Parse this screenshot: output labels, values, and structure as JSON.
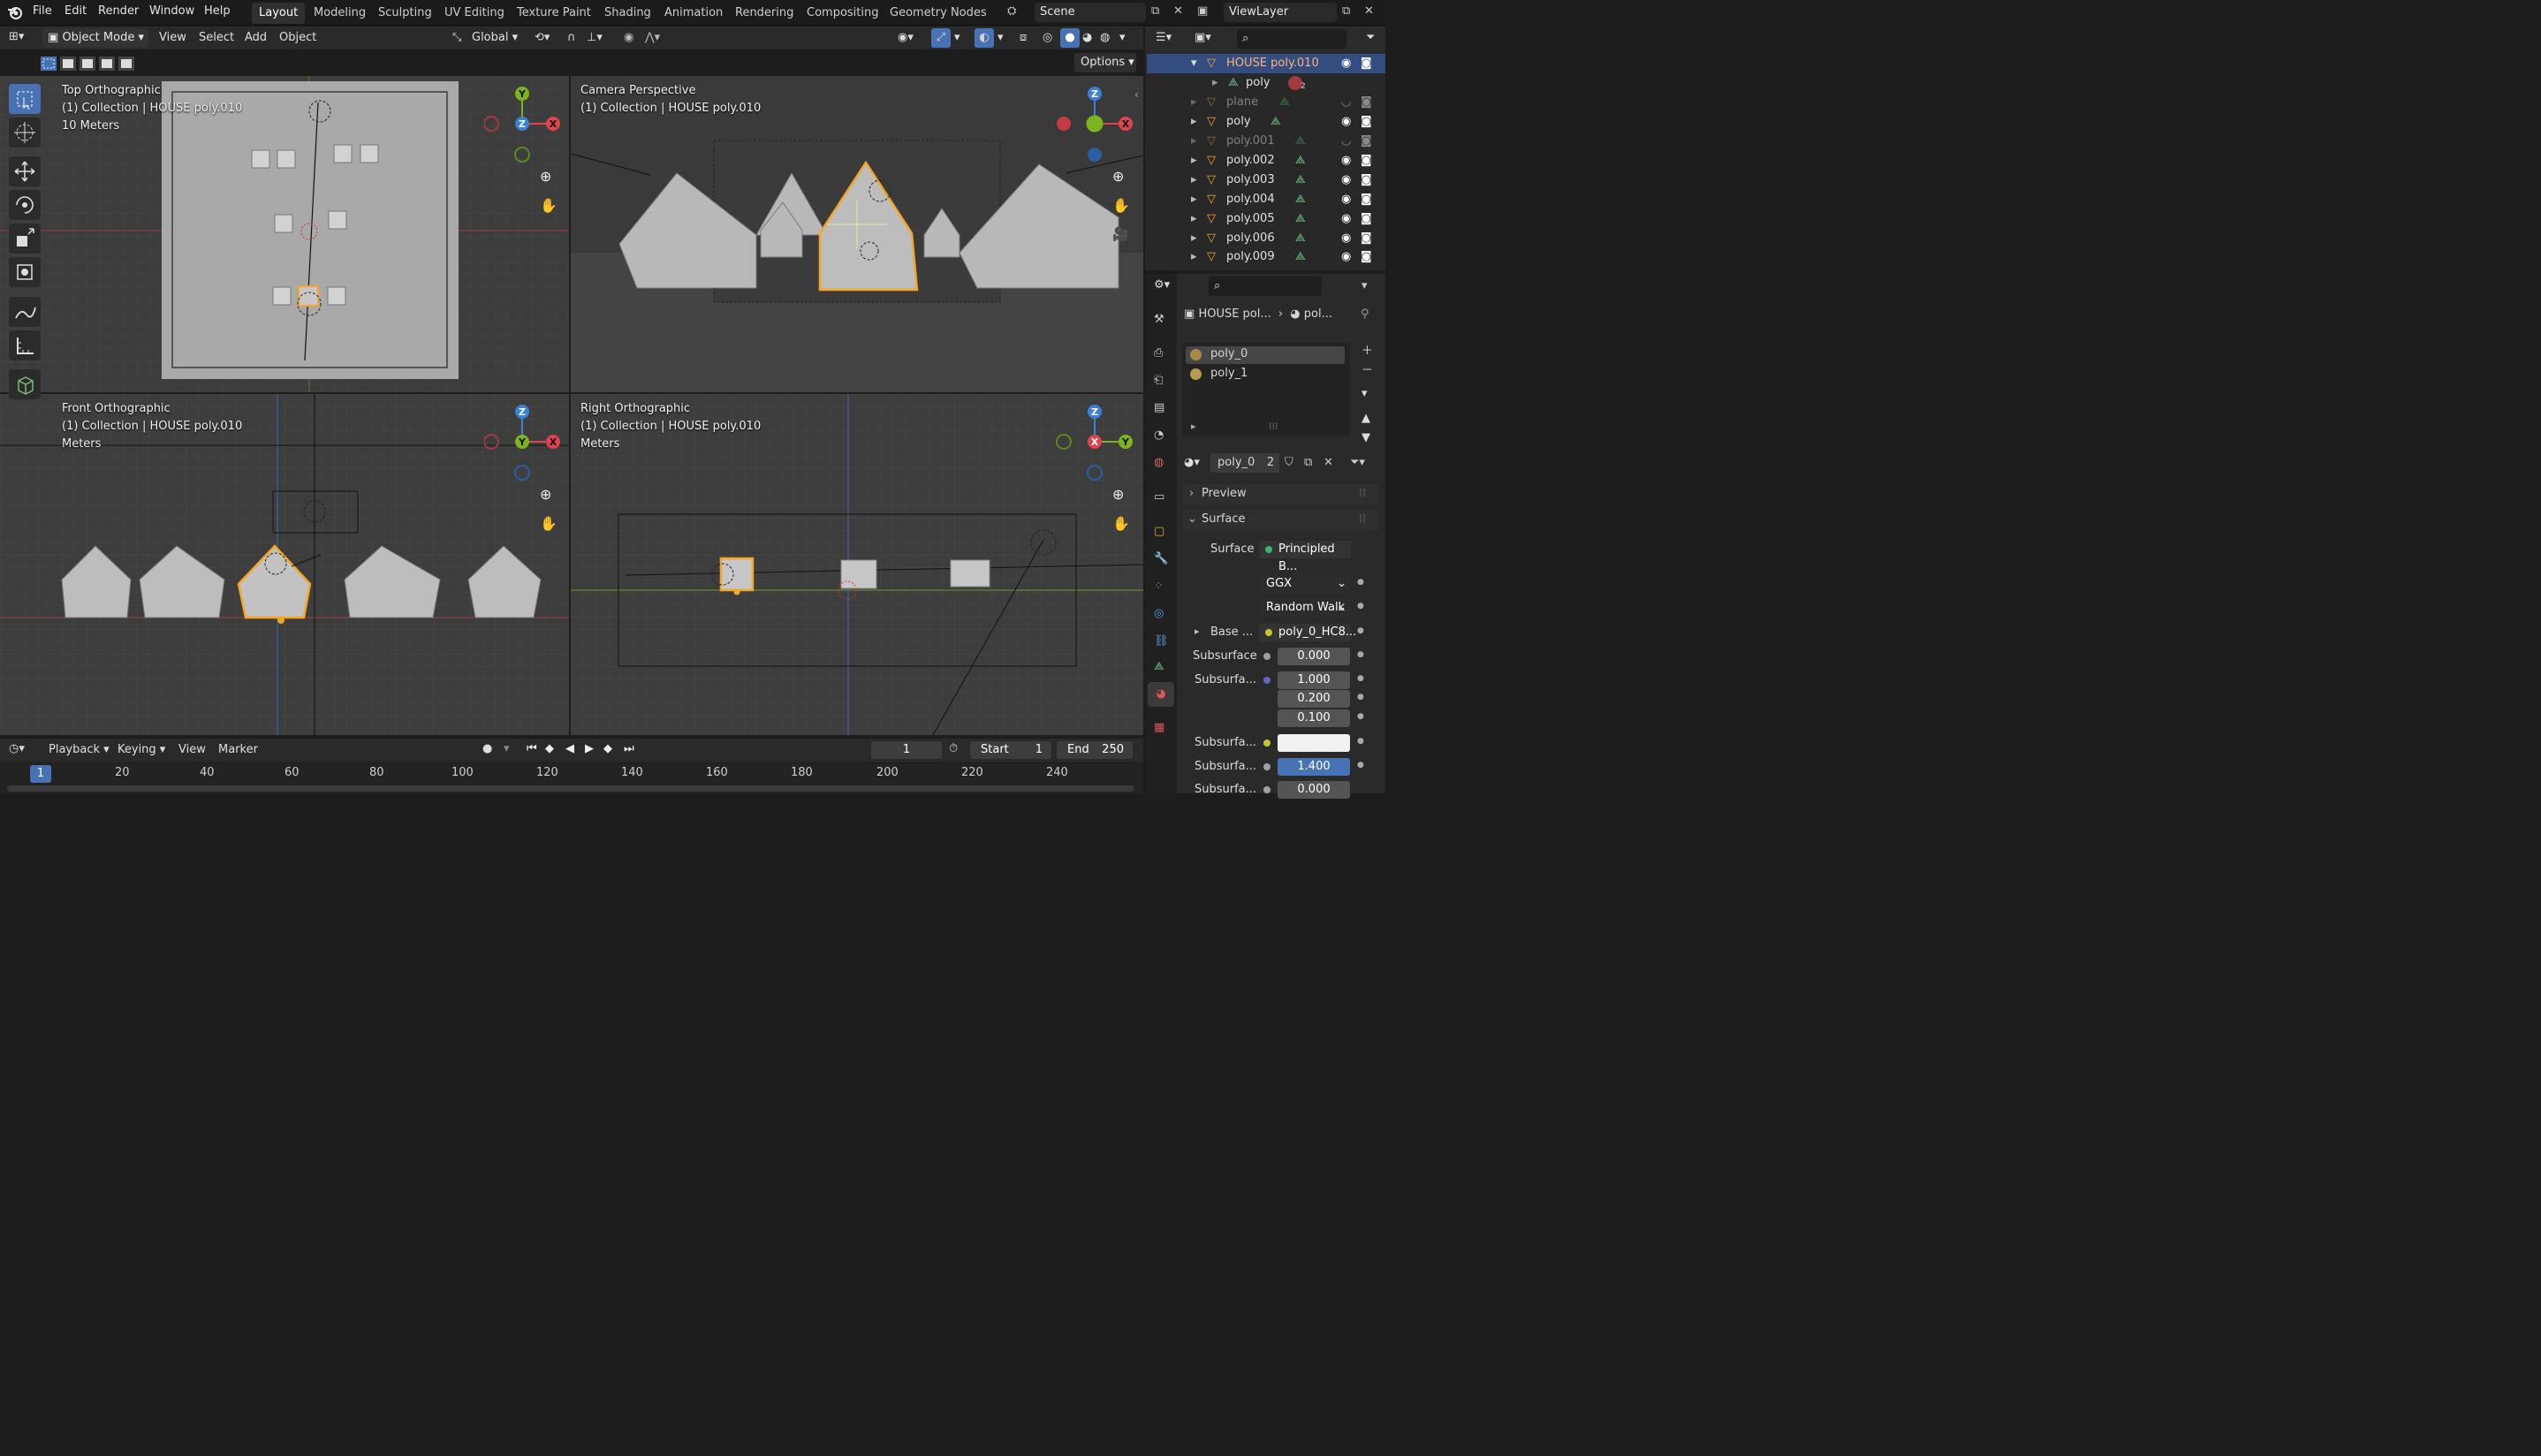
{
  "menubar": {
    "items": [
      "File",
      "Edit",
      "Render",
      "Window",
      "Help"
    ],
    "workspaces": [
      "Layout",
      "Modeling",
      "Sculpting",
      "UV Editing",
      "Texture Paint",
      "Shading",
      "Animation",
      "Rendering",
      "Compositing",
      "Geometry Nodes"
    ],
    "active_workspace": "Layout",
    "scene": "Scene",
    "view_layer": "ViewLayer"
  },
  "viewport_header": {
    "mode": "Object Mode",
    "menus": [
      "View",
      "Select",
      "Add",
      "Object"
    ],
    "transform_orientation": "Global",
    "options": "Options"
  },
  "viewports": {
    "top": {
      "title": "Top Orthographic",
      "collection": "(1) Collection | HOUSE poly.010",
      "scale": "10 Meters"
    },
    "camera": {
      "title": "Camera Perspective",
      "collection": "(1) Collection | HOUSE poly.010"
    },
    "front": {
      "title": "Front Orthographic",
      "collection": "(1) Collection | HOUSE poly.010",
      "scale": "Meters"
    },
    "right": {
      "title": "Right Orthographic",
      "collection": "(1) Collection | HOUSE poly.010",
      "scale": "Meters"
    }
  },
  "gizmo_labels": {
    "x": "X",
    "y": "Y",
    "z": "Z"
  },
  "outliner": {
    "rows": [
      {
        "name": "HOUSE poly.010",
        "selected": true,
        "dim": false
      },
      {
        "name": "poly",
        "selected": false,
        "dim": false,
        "child": true,
        "badge": "2"
      },
      {
        "name": "plane",
        "selected": false,
        "dim": true
      },
      {
        "name": "poly",
        "selected": false,
        "dim": false
      },
      {
        "name": "poly.001",
        "selected": false,
        "dim": true
      },
      {
        "name": "poly.002",
        "selected": false,
        "dim": false
      },
      {
        "name": "poly.003",
        "selected": false,
        "dim": false
      },
      {
        "name": "poly.004",
        "selected": false,
        "dim": false
      },
      {
        "name": "poly.005",
        "selected": false,
        "dim": false
      },
      {
        "name": "poly.006",
        "selected": false,
        "dim": false
      },
      {
        "name": "poly.009",
        "selected": false,
        "dim": false
      }
    ]
  },
  "properties": {
    "breadcrumb_object": "HOUSE pol...",
    "breadcrumb_material": "pol...",
    "material_slots": [
      "poly_0",
      "poly_1"
    ],
    "material_name": "poly_0",
    "user_count": "2",
    "panels": {
      "preview": "Preview",
      "surface": "Surface"
    },
    "rows": {
      "surface_label": "Surface",
      "surface_value": "Principled B...",
      "distribution": "GGX",
      "subsurface_method": "Random Walk",
      "base_label": "Base ...",
      "base_value": "poly_0_HC8...",
      "subsurface_label": "Subsurface",
      "subsurface_value": "0.000",
      "radius_label": "Subsurfa...",
      "radius_values": [
        "1.000",
        "0.200",
        "0.100"
      ],
      "color_label": "Subsurfa...",
      "ior_label": "Subsurfa...",
      "ior_value": "1.400",
      "aniso_label": "Subsurfa...",
      "aniso_value": "0.000"
    }
  },
  "timeline": {
    "menus": [
      "Playback",
      "Keying",
      "View",
      "Marker"
    ],
    "current_frame": "1",
    "start_label": "Start",
    "start": "1",
    "end_label": "End",
    "end": "250",
    "ruler": [
      "20",
      "40",
      "60",
      "80",
      "100",
      "120",
      "140",
      "160",
      "180",
      "200",
      "220",
      "240"
    ],
    "playhead": "1"
  },
  "colors": {
    "accent": "#4772b3",
    "selection": "#f5a623",
    "x_axis": "#e0434d",
    "y_axis": "#7ab51d",
    "z_axis": "#3b82d6"
  }
}
